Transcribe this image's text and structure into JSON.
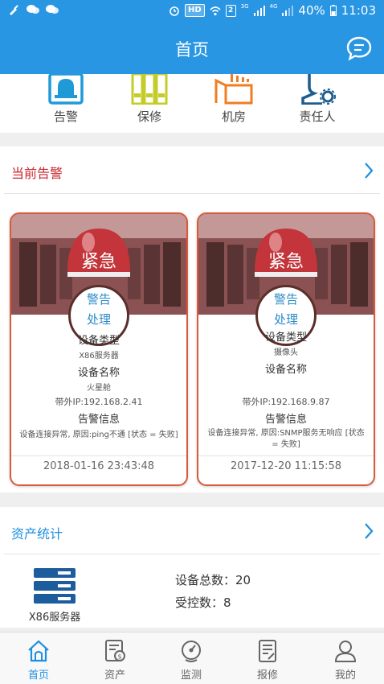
{
  "status_bar": {
    "hd": "HD",
    "sim": "2",
    "net_3g": "3G",
    "net_4g": "4G",
    "battery": "40%",
    "time": "11:03"
  },
  "app_bar": {
    "title": "首页",
    "chat_icon": "chat-bubble-icon"
  },
  "quick_menu": [
    {
      "label": "告警",
      "icon": "bell-icon",
      "color": "#1f9ad7"
    },
    {
      "label": "保修",
      "icon": "binders-icon",
      "color": "#c5cc2a"
    },
    {
      "label": "机房",
      "icon": "server-room-icon",
      "color": "#f07d20"
    },
    {
      "label": "责任人",
      "icon": "person-gear-icon",
      "color": "#1d5d8f"
    }
  ],
  "current_alarms": {
    "title": "当前告警",
    "title_color": "#c9262b",
    "image_text": "紧急",
    "cards": [
      {
        "badge": "警告",
        "action": "处理",
        "type_label": "设备类型",
        "type_value": "X86服务器",
        "name_label": "设备名称",
        "name_value": "火星舱",
        "ip": "带外IP:192.168.2.41",
        "info_label": "告警信息",
        "info_value": "设备连接异常, 原因:ping不通 [状态 = 失败]",
        "time": "2018-01-16 23:43:48"
      },
      {
        "badge": "警告",
        "action": "处理",
        "type_label": "设备类型",
        "type_value": "摄像头",
        "name_label": "设备名称",
        "name_value": "",
        "ip": "带外IP:192.168.9.87",
        "info_label": "告警信息",
        "info_value": "设备连接异常, 原因:SNMP服务无响应 [状态 = 失败]",
        "time": "2017-12-20 11:15:58"
      }
    ]
  },
  "asset_stats": {
    "title": "资产统计",
    "title_color": "#1d8fe0",
    "item_name": "X86服务器",
    "item_icon": "server-stack-icon",
    "total": "设备总数：20",
    "managed": "受控数：8"
  },
  "bottom_nav": [
    {
      "label": "首页",
      "icon": "home-icon",
      "active": true
    },
    {
      "label": "资产",
      "icon": "asset-doc-icon",
      "active": false
    },
    {
      "label": "监测",
      "icon": "monitor-gauge-icon",
      "active": false
    },
    {
      "label": "报修",
      "icon": "repair-form-icon",
      "active": false
    },
    {
      "label": "我的",
      "icon": "user-icon",
      "active": false
    }
  ]
}
